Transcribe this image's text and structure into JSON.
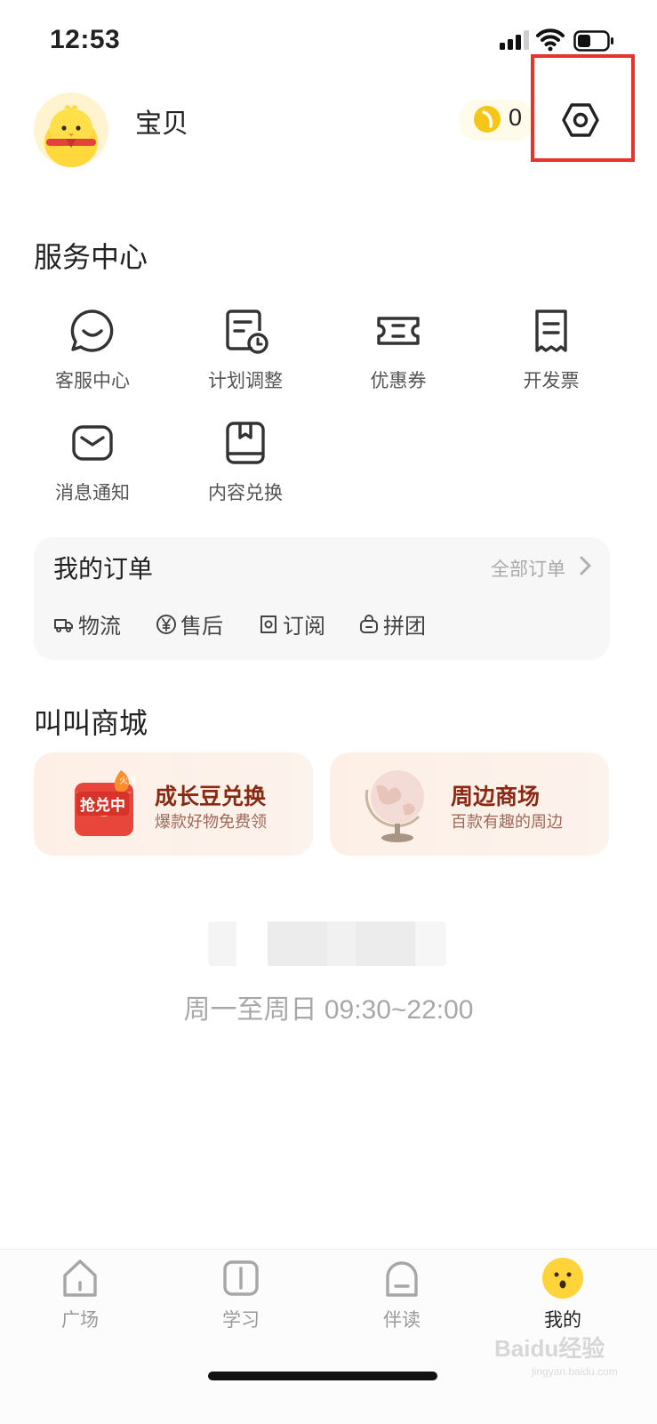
{
  "status_bar": {
    "time": "12:53"
  },
  "profile": {
    "name": "宝贝",
    "coin_count": "0"
  },
  "service_center": {
    "title": "服务中心",
    "items": [
      {
        "label": "客服中心",
        "icon": "chat-icon"
      },
      {
        "label": "计划调整",
        "icon": "schedule-icon"
      },
      {
        "label": "优惠券",
        "icon": "coupon-icon"
      },
      {
        "label": "开发票",
        "icon": "invoice-icon"
      },
      {
        "label": "消息通知",
        "icon": "mail-icon"
      },
      {
        "label": "内容兑换",
        "icon": "redeem-box-icon"
      }
    ]
  },
  "orders": {
    "title": "我的订单",
    "all_label": "全部订单",
    "items": [
      {
        "label": "物流",
        "icon": "truck-icon"
      },
      {
        "label": "售后",
        "icon": "yen-icon"
      },
      {
        "label": "订阅",
        "icon": "subscribe-icon"
      },
      {
        "label": "拼团",
        "icon": "bag-icon"
      }
    ]
  },
  "mall": {
    "title": "叫叫商城",
    "cards": [
      {
        "title": "成长豆兑换",
        "subtitle": "爆款好物免费领",
        "badge": "抢兑中",
        "tag": "火爆"
      },
      {
        "title": "周边商场",
        "subtitle": "百款有趣的周边"
      }
    ]
  },
  "service_hours": "周一至周日 09:30~22:00",
  "tabbar": {
    "tabs": [
      {
        "label": "广场",
        "icon": "home-icon"
      },
      {
        "label": "学习",
        "icon": "book-icon"
      },
      {
        "label": "伴读",
        "icon": "companion-icon"
      },
      {
        "label": "我的",
        "icon": "profile-face-icon"
      }
    ]
  },
  "watermark": {
    "text": "Baidu经验",
    "sub": "jingyan.baidu.com"
  },
  "colors": {
    "highlight": "#e8322b",
    "accent_yellow": "#ffd43b",
    "mall_title": "#8a2a14"
  }
}
